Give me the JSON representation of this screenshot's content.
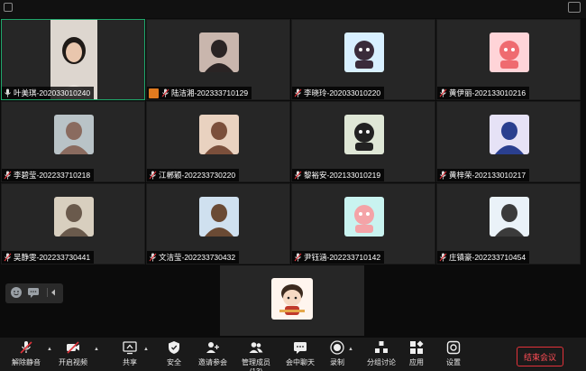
{
  "participants": [
    {
      "name": "叶美琪-202033010240",
      "kind": "video",
      "muted": false,
      "active": true
    },
    {
      "name": "陆洁湘-202333710129",
      "kind": "photo",
      "muted": true,
      "host": true,
      "colors": [
        "#c9b6ad",
        "#2a2424"
      ]
    },
    {
      "name": "李晓玲-202033010220",
      "kind": "cartoon",
      "muted": true,
      "colors": [
        "#d8f0ff",
        "#3a2c3a"
      ]
    },
    {
      "name": "黄伊丽-202133010216",
      "kind": "cartoon",
      "muted": true,
      "colors": [
        "#ffd4d8",
        "#ef6b70"
      ]
    },
    {
      "name": "李碧莹-202233710218",
      "kind": "photo",
      "muted": true,
      "colors": [
        "#b9c3c7",
        "#8a6b5f"
      ]
    },
    {
      "name": "江郴颖-202233730220",
      "kind": "photo",
      "muted": true,
      "colors": [
        "#e9d2c0",
        "#7b4f3b"
      ]
    },
    {
      "name": "黎裕安-202133010219",
      "kind": "cartoon",
      "muted": true,
      "colors": [
        "#dfe7d6",
        "#222222"
      ]
    },
    {
      "name": "黄梓荣-202133010217",
      "kind": "photo",
      "muted": true,
      "colors": [
        "#e6e2f6",
        "#2a3f8f"
      ]
    },
    {
      "name": "吴静雯-202233730441",
      "kind": "photo",
      "muted": true,
      "colors": [
        "#d8cfbf",
        "#6a5a4c"
      ]
    },
    {
      "name": "文洁莹-202233730432",
      "kind": "photo",
      "muted": true,
      "colors": [
        "#cfe0ef",
        "#6a4a34"
      ]
    },
    {
      "name": "尹钰涵-202233710142",
      "kind": "cartoon",
      "muted": true,
      "colors": [
        "#c9f3f0",
        "#f4a3a7"
      ]
    },
    {
      "name": "庄镇豪-202233710454",
      "kind": "photo",
      "muted": true,
      "colors": [
        "#eaf2f8",
        "#3b3b3b"
      ]
    }
  ],
  "speaker": {
    "kind": "cartoon",
    "colors": [
      "#fff5ee",
      "#c0392b"
    ]
  },
  "toolbar": {
    "unmute": "解除静音",
    "start_video": "开启视频",
    "share": "共享",
    "security": "安全",
    "invite": "邀请参会",
    "participants": "管理成员(13)",
    "chat": "会中聊天",
    "record": "录制",
    "breakout": "分组讨论",
    "apps": "应用",
    "settings": "设置",
    "end": "结束会议"
  },
  "colors": {
    "active_border": "#1fa76b",
    "end_red": "#e2323a",
    "host_badge": "#e07a1f"
  }
}
